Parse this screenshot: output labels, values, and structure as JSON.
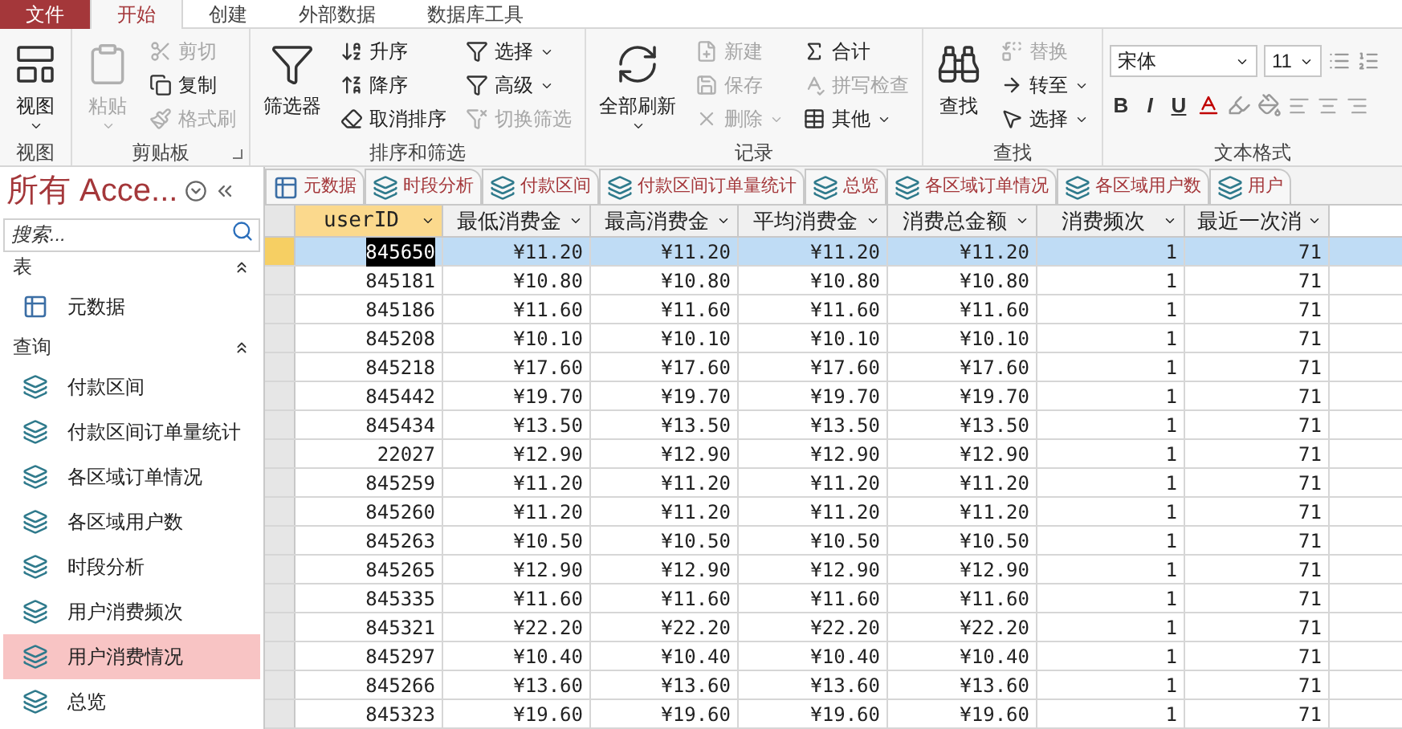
{
  "menu_tabs": [
    {
      "label": "文件",
      "kind": "file",
      "selected": false
    },
    {
      "label": "开始",
      "kind": "tab",
      "selected": true
    },
    {
      "label": "创建",
      "kind": "tab",
      "selected": false
    },
    {
      "label": "外部数据",
      "kind": "tab",
      "selected": false
    },
    {
      "label": "数据库工具",
      "kind": "tab",
      "selected": false
    }
  ],
  "ribbon": {
    "groups": [
      {
        "label": "视图",
        "columns": [
          [
            {
              "label": "视图",
              "kind": "large",
              "disabled": false,
              "menu": true
            }
          ]
        ]
      },
      {
        "label": "剪贴板",
        "launcher": true,
        "columns": [
          [
            {
              "label": "粘贴",
              "kind": "large",
              "disabled": true,
              "menu": true
            }
          ],
          [
            {
              "label": "剪切",
              "kind": "small",
              "disabled": true,
              "menu": false
            },
            {
              "label": "复制",
              "kind": "small",
              "disabled": false,
              "menu": false
            },
            {
              "label": "格式刷",
              "kind": "small",
              "disabled": true,
              "menu": false
            }
          ]
        ]
      },
      {
        "label": "排序和筛选",
        "columns": [
          [
            {
              "label": "筛选器",
              "kind": "large",
              "disabled": false,
              "menu": false
            }
          ],
          [
            {
              "label": "升序",
              "kind": "small",
              "disabled": false,
              "menu": false
            },
            {
              "label": "降序",
              "kind": "small",
              "disabled": false,
              "menu": false
            },
            {
              "label": "取消排序",
              "kind": "small",
              "disabled": false,
              "menu": false
            }
          ],
          [
            {
              "label": "选择",
              "kind": "small",
              "disabled": false,
              "menu": true
            },
            {
              "label": "高级",
              "kind": "small",
              "disabled": false,
              "menu": true
            },
            {
              "label": "切换筛选",
              "kind": "small",
              "disabled": true,
              "menu": false
            }
          ]
        ]
      },
      {
        "label": "记录",
        "columns": [
          [
            {
              "label": "全部刷新",
              "kind": "large",
              "disabled": false,
              "menu": true
            }
          ],
          [
            {
              "label": "新建",
              "kind": "small",
              "disabled": true,
              "menu": false
            },
            {
              "label": "保存",
              "kind": "small",
              "disabled": true,
              "menu": false
            },
            {
              "label": "删除",
              "kind": "small",
              "disabled": true,
              "menu": true
            }
          ],
          [
            {
              "label": "合计",
              "kind": "small",
              "disabled": false,
              "menu": false
            },
            {
              "label": "拼写检查",
              "kind": "small",
              "disabled": true,
              "menu": false
            },
            {
              "label": "其他",
              "kind": "small",
              "disabled": false,
              "menu": true
            }
          ]
        ]
      },
      {
        "label": "查找",
        "columns": [
          [
            {
              "label": "查找",
              "kind": "large",
              "disabled": false,
              "menu": false
            }
          ],
          [
            {
              "label": "替换",
              "kind": "small",
              "disabled": true,
              "menu": false
            },
            {
              "label": "转至",
              "kind": "small",
              "disabled": false,
              "menu": true
            },
            {
              "label": "选择",
              "kind": "small",
              "disabled": false,
              "menu": true
            }
          ]
        ]
      }
    ],
    "text_format": {
      "label": "文本格式",
      "font": "宋体",
      "size": "11",
      "styles": [
        "B",
        "I",
        "U"
      ]
    }
  },
  "navigation": {
    "title": "所有 Acce...",
    "search": {
      "placeholder": "搜索..."
    },
    "groups": [
      {
        "label": "表",
        "kind": "table",
        "items": [
          {
            "label": "元数据",
            "selected": false
          }
        ]
      },
      {
        "label": "查询",
        "kind": "query",
        "items": [
          {
            "label": "付款区间",
            "selected": false
          },
          {
            "label": "付款区间订单量统计",
            "selected": false
          },
          {
            "label": "各区域订单情况",
            "selected": false
          },
          {
            "label": "各区域用户数",
            "selected": false
          },
          {
            "label": "时段分析",
            "selected": false
          },
          {
            "label": "用户消费频次",
            "selected": false
          },
          {
            "label": "用户消费情况",
            "selected": true
          },
          {
            "label": "总览",
            "selected": false
          }
        ]
      }
    ]
  },
  "document_tabs": [
    {
      "label": "元数据",
      "kind": "table",
      "selected": false
    },
    {
      "label": "时段分析",
      "kind": "query",
      "selected": false
    },
    {
      "label": "付款区间",
      "kind": "query",
      "selected": false
    },
    {
      "label": "付款区间订单量统计",
      "kind": "query",
      "selected": false
    },
    {
      "label": "总览",
      "kind": "query",
      "selected": false
    },
    {
      "label": "各区域订单情况",
      "kind": "query",
      "selected": false
    },
    {
      "label": "各区域用户数",
      "kind": "query",
      "selected": false
    },
    {
      "label": "用户",
      "kind": "query",
      "selected": false
    }
  ],
  "table": {
    "columns": [
      {
        "label": "userID",
        "selected": true
      },
      {
        "label": "最低消费金",
        "selected": false
      },
      {
        "label": "最高消费金",
        "selected": false
      },
      {
        "label": "平均消费金",
        "selected": false
      },
      {
        "label": "消费总金额",
        "selected": false
      },
      {
        "label": "消费频次",
        "selected": false
      },
      {
        "label": "最近一次消",
        "selected": false
      }
    ],
    "rows": [
      {
        "selected": true,
        "cells": [
          "845650",
          "¥11.20",
          "¥11.20",
          "¥11.20",
          "¥11.20",
          "1",
          "71"
        ]
      },
      {
        "selected": false,
        "cells": [
          "845181",
          "¥10.80",
          "¥10.80",
          "¥10.80",
          "¥10.80",
          "1",
          "71"
        ]
      },
      {
        "selected": false,
        "cells": [
          "845186",
          "¥11.60",
          "¥11.60",
          "¥11.60",
          "¥11.60",
          "1",
          "71"
        ]
      },
      {
        "selected": false,
        "cells": [
          "845208",
          "¥10.10",
          "¥10.10",
          "¥10.10",
          "¥10.10",
          "1",
          "71"
        ]
      },
      {
        "selected": false,
        "cells": [
          "845218",
          "¥17.60",
          "¥17.60",
          "¥17.60",
          "¥17.60",
          "1",
          "71"
        ]
      },
      {
        "selected": false,
        "cells": [
          "845442",
          "¥19.70",
          "¥19.70",
          "¥19.70",
          "¥19.70",
          "1",
          "71"
        ]
      },
      {
        "selected": false,
        "cells": [
          "845434",
          "¥13.50",
          "¥13.50",
          "¥13.50",
          "¥13.50",
          "1",
          "71"
        ]
      },
      {
        "selected": false,
        "cells": [
          "22027",
          "¥12.90",
          "¥12.90",
          "¥12.90",
          "¥12.90",
          "1",
          "71"
        ]
      },
      {
        "selected": false,
        "cells": [
          "845259",
          "¥11.20",
          "¥11.20",
          "¥11.20",
          "¥11.20",
          "1",
          "71"
        ]
      },
      {
        "selected": false,
        "cells": [
          "845260",
          "¥11.20",
          "¥11.20",
          "¥11.20",
          "¥11.20",
          "1",
          "71"
        ]
      },
      {
        "selected": false,
        "cells": [
          "845263",
          "¥10.50",
          "¥10.50",
          "¥10.50",
          "¥10.50",
          "1",
          "71"
        ]
      },
      {
        "selected": false,
        "cells": [
          "845265",
          "¥12.90",
          "¥12.90",
          "¥12.90",
          "¥12.90",
          "1",
          "71"
        ]
      },
      {
        "selected": false,
        "cells": [
          "845335",
          "¥11.60",
          "¥11.60",
          "¥11.60",
          "¥11.60",
          "1",
          "71"
        ]
      },
      {
        "selected": false,
        "cells": [
          "845321",
          "¥22.20",
          "¥22.20",
          "¥22.20",
          "¥22.20",
          "1",
          "71"
        ]
      },
      {
        "selected": false,
        "cells": [
          "845297",
          "¥10.40",
          "¥10.40",
          "¥10.40",
          "¥10.40",
          "1",
          "71"
        ]
      },
      {
        "selected": false,
        "cells": [
          "845266",
          "¥13.60",
          "¥13.60",
          "¥13.60",
          "¥13.60",
          "1",
          "71"
        ]
      },
      {
        "selected": false,
        "cells": [
          "845323",
          "¥19.60",
          "¥19.60",
          "¥19.60",
          "¥19.60",
          "1",
          "71"
        ]
      }
    ]
  }
}
